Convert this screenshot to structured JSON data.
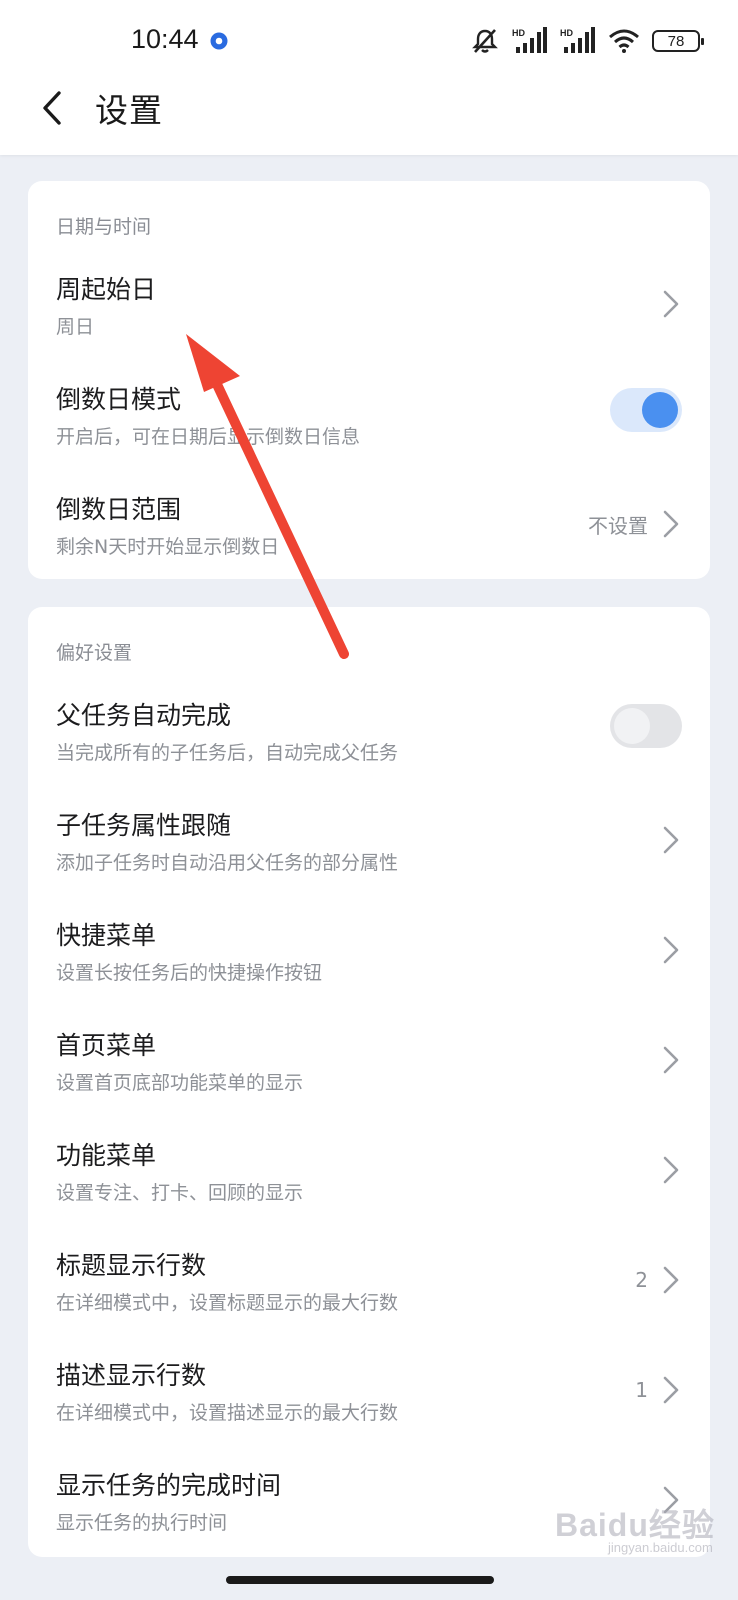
{
  "status_bar": {
    "time": "10:44",
    "battery": "78",
    "icons": [
      "app-notification-icon",
      "mute-icon",
      "hd-signal-1-icon",
      "hd-signal-2-icon",
      "wifi-icon",
      "battery-icon"
    ],
    "network_label_1": "HD",
    "network_label_2": "HD"
  },
  "header": {
    "title": "设置",
    "back_icon": "chevron-left-icon"
  },
  "sections": [
    {
      "title": "日期与时间",
      "rows": [
        {
          "title": "周起始日",
          "subtitle": "周日",
          "control": "chevron"
        },
        {
          "title": "倒数日模式",
          "subtitle": "开启后，可在日期后显示倒数日信息",
          "control": "toggle",
          "on": true
        },
        {
          "title": "倒数日范围",
          "subtitle": "剩余N天时开始显示倒数日",
          "value": "不设置",
          "control": "chevron"
        }
      ]
    },
    {
      "title": "偏好设置",
      "rows": [
        {
          "title": "父任务自动完成",
          "subtitle": "当完成所有的子任务后，自动完成父任务",
          "control": "toggle",
          "on": false
        },
        {
          "title": "子任务属性跟随",
          "subtitle": "添加子任务时自动沿用父任务的部分属性",
          "control": "chevron"
        },
        {
          "title": "快捷菜单",
          "subtitle": "设置长按任务后的快捷操作按钮",
          "control": "chevron"
        },
        {
          "title": "首页菜单",
          "subtitle": "设置首页底部功能菜单的显示",
          "control": "chevron"
        },
        {
          "title": "功能菜单",
          "subtitle": "设置专注、打卡、回顾的显示",
          "control": "chevron"
        },
        {
          "title": "标题显示行数",
          "subtitle": "在详细模式中，设置标题显示的最大行数",
          "value": "2",
          "control": "chevron"
        },
        {
          "title": "描述显示行数",
          "subtitle": "在详细模式中，设置描述显示的最大行数",
          "value": "1",
          "control": "chevron"
        },
        {
          "title": "显示任务的完成时间",
          "subtitle": "显示任务的执行时间",
          "control": "chevron"
        }
      ]
    }
  ],
  "colors": {
    "background": "#eceff5",
    "card": "#ffffff",
    "accent": "#4a90f0",
    "annotation": "#ee4433"
  },
  "watermark": {
    "text": "Baidu经验",
    "sub": "jingyan.baidu.com"
  }
}
